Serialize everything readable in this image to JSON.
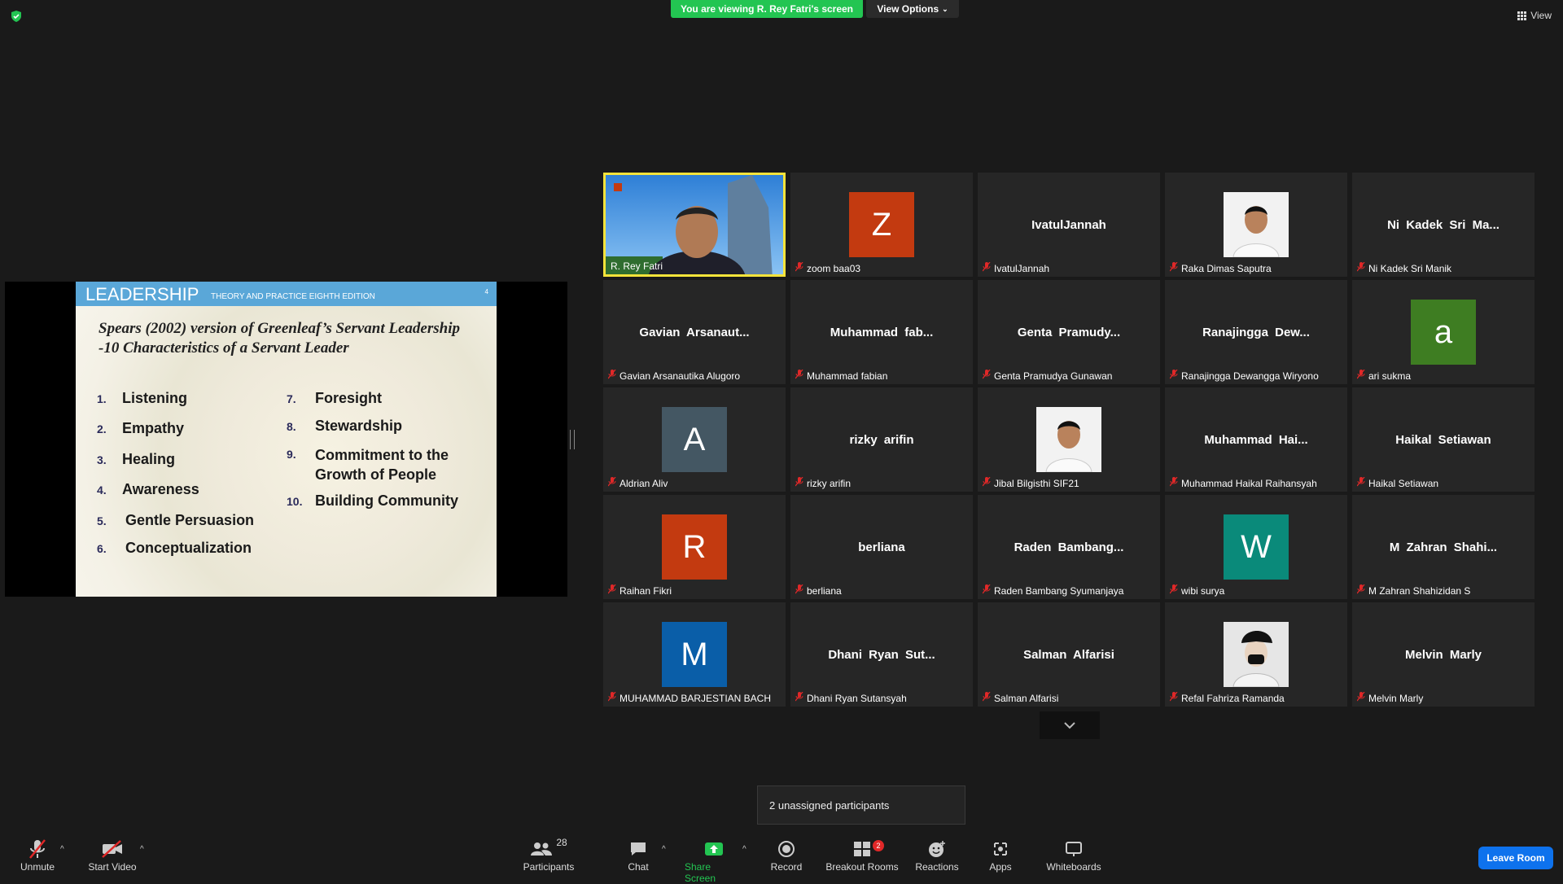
{
  "top": {
    "viewing_text": "You are viewing R. Rey Fatri's screen",
    "view_options_label": "View Options",
    "view_label": "View"
  },
  "slide": {
    "brand": "LEADERSHIP",
    "subtitle": "THEORY AND PRACTICE  EIGHTH EDITION",
    "page": "4",
    "heading_line1": "Spears (2002) version of Greenleaf’s Servant Leadership",
    "heading_line2": "-10 Characteristics of a Servant Leader",
    "items": [
      {
        "num": "1.",
        "text": "Listening"
      },
      {
        "num": "2.",
        "text": "Empathy"
      },
      {
        "num": "3.",
        "text": "Healing"
      },
      {
        "num": "4.",
        "text": "Awareness"
      },
      {
        "num": "5.",
        "text": "Gentle Persuasion"
      },
      {
        "num": "6.",
        "text": "Conceptualization"
      },
      {
        "num": "7.",
        "text": "Foresight"
      },
      {
        "num": "8.",
        "text": "Stewardship"
      },
      {
        "num": "9.",
        "text": "Commitment to the Growth of People"
      },
      {
        "num": "10.",
        "text": "Building Community"
      }
    ]
  },
  "tiles": [
    {
      "label": "R. Rey Fatri",
      "type": "video",
      "active": true
    },
    {
      "label": "zoom baa03",
      "type": "letter",
      "letter": "Z",
      "color": "#c33a10"
    },
    {
      "label": "IvatulJannah",
      "type": "name",
      "display": "IvatulJannah"
    },
    {
      "label": "Raka Dimas Saputra",
      "type": "photo"
    },
    {
      "label": "Ni Kadek Sri Manik",
      "type": "name",
      "display": "Ni Kadek Sri Ma..."
    },
    {
      "label": "Gavian Arsanautika Alugoro",
      "type": "name",
      "display": "Gavian Arsanaut..."
    },
    {
      "label": "Muhammad fabian",
      "type": "name",
      "display": "Muhammad fab..."
    },
    {
      "label": "Genta Pramudya Gunawan",
      "type": "name",
      "display": "Genta Pramudy..."
    },
    {
      "label": "Ranajingga Dewangga Wiryono",
      "type": "name",
      "display": "Ranajingga Dew..."
    },
    {
      "label": "ari sukma",
      "type": "letter",
      "letter": "a",
      "color": "#3e7d22"
    },
    {
      "label": "Aldrian Aliv",
      "type": "letter",
      "letter": "A",
      "color": "#445763"
    },
    {
      "label": "rizky arifin",
      "type": "name",
      "display": "rizky arifin"
    },
    {
      "label": "Jibal Bilgisthi SIF21",
      "type": "photo"
    },
    {
      "label": "Muhammad Haikal Raihansyah",
      "type": "name",
      "display": "Muhammad Hai..."
    },
    {
      "label": "Haikal Setiawan",
      "type": "name",
      "display": "Haikal Setiawan"
    },
    {
      "label": "Raihan Fikri",
      "type": "letter",
      "letter": "R",
      "color": "#c33a10"
    },
    {
      "label": "berliana",
      "type": "name",
      "display": "berliana"
    },
    {
      "label": "Raden Bambang Syumanjaya",
      "type": "name",
      "display": "Raden Bambang..."
    },
    {
      "label": "wibi surya",
      "type": "letter",
      "letter": "W",
      "color": "#0a8a7a"
    },
    {
      "label": "M Zahran Shahizidan S",
      "type": "name",
      "display": "M Zahran Shahi..."
    },
    {
      "label": "MUHAMMAD BARJESTIAN BACH",
      "type": "letter",
      "letter": "M",
      "color": "#0a5ea8"
    },
    {
      "label": "Dhani Ryan Sutansyah",
      "type": "name",
      "display": "Dhani Ryan Sut..."
    },
    {
      "label": "Salman Alfarisi",
      "type": "name",
      "display": "Salman Alfarisi"
    },
    {
      "label": "Refal Fahriza Ramanda",
      "type": "photo-mask"
    },
    {
      "label": "Melvin Marly",
      "type": "name",
      "display": "Melvin Marly"
    }
  ],
  "popup": {
    "text": "2 unassigned participants"
  },
  "toolbar": {
    "unmute": "Unmute",
    "start_video": "Start Video",
    "participants": "Participants",
    "participants_count": "28",
    "chat": "Chat",
    "share_screen": "Share Screen",
    "record": "Record",
    "breakout_rooms": "Breakout Rooms",
    "breakout_badge": "2",
    "reactions": "Reactions",
    "apps": "Apps",
    "whiteboards": "Whiteboards",
    "leave_room": "Leave Room"
  }
}
